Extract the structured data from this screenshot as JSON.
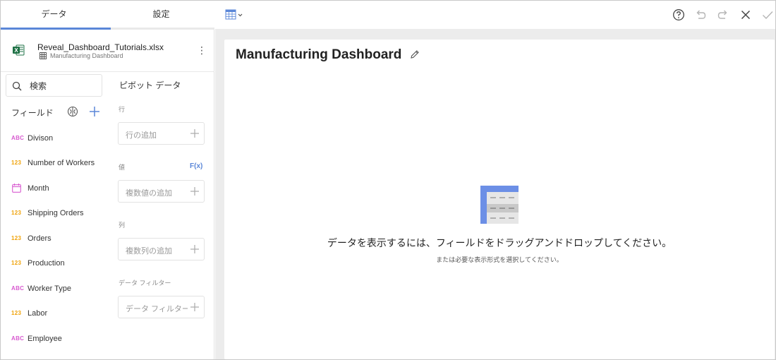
{
  "tabs": [
    {
      "label": "データ",
      "active": true
    },
    {
      "label": "設定",
      "active": false
    }
  ],
  "datasource": {
    "file_name": "Reveal_Dashboard_Tutorials.xlsx",
    "sheet_name": "Manufacturing Dashboard"
  },
  "search": {
    "placeholder": "検索"
  },
  "fields": {
    "title": "フィールド",
    "items": [
      {
        "type": "ABC",
        "label": "Divison"
      },
      {
        "type": "123",
        "label": "Number of Workers"
      },
      {
        "type": "date",
        "label": "Month"
      },
      {
        "type": "123",
        "label": "Shipping Orders"
      },
      {
        "type": "123",
        "label": "Orders"
      },
      {
        "type": "123",
        "label": "Production"
      },
      {
        "type": "ABC",
        "label": "Worker Type"
      },
      {
        "type": "123",
        "label": "Labor"
      },
      {
        "type": "ABC",
        "label": "Employee"
      }
    ]
  },
  "pivot": {
    "title": "ピボット データ",
    "rows_label": "行",
    "rows_placeholder": "行の追加",
    "values_label": "値",
    "fx_label": "F(x)",
    "values_placeholder": "複数値の追加",
    "columns_label": "列",
    "columns_placeholder": "複数列の追加",
    "filters_label": "データ フィルター",
    "filters_placeholder": "データ フィルター..."
  },
  "dashboard": {
    "title": "Manufacturing Dashboard",
    "empty_message": "データを表示するには、フィールドをドラッグアンドドロップしてください。",
    "empty_sub": "または必要な表示形式を選択してください。"
  },
  "colors": {
    "accent": "#5b87d8",
    "abc_type": "#d85bd0",
    "number_type": "#f0a30a",
    "excel": "#1e7145"
  }
}
